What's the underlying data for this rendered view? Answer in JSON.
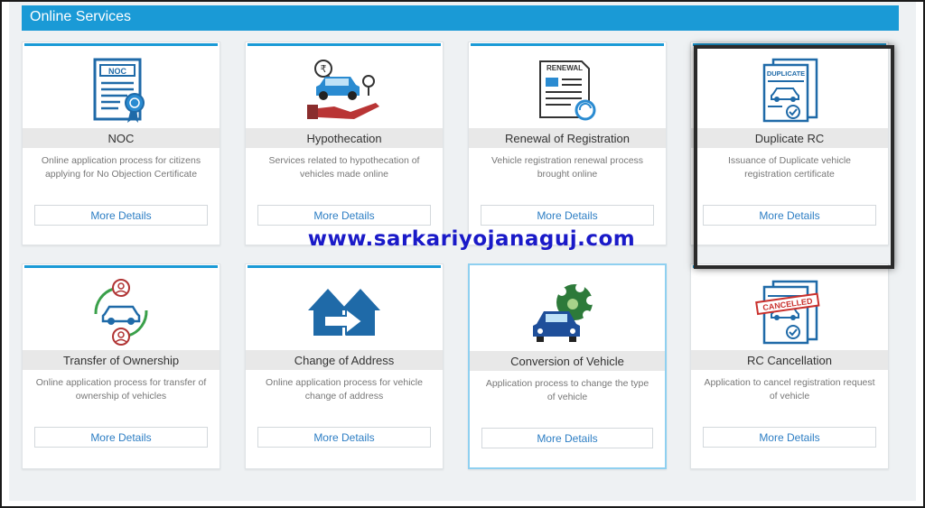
{
  "section": {
    "title": "Online Services"
  },
  "cards": [
    {
      "title": "NOC",
      "desc": "Online application process for citizens applying for No Objection Certificate",
      "button": "More Details",
      "icon": "noc-certificate-icon"
    },
    {
      "title": "Hypothecation",
      "desc": "Services related to hypothecation of vehicles made online",
      "button": "More Details",
      "icon": "car-hypothecation-icon"
    },
    {
      "title": "Renewal of Registration",
      "desc": "Vehicle registration renewal process brought online",
      "button": "More Details",
      "icon": "renewal-document-icon",
      "badge": "RENEWAL"
    },
    {
      "title": "Duplicate RC",
      "desc": "Issuance of Duplicate vehicle registration certificate",
      "button": "More Details",
      "icon": "duplicate-rc-icon",
      "badge": "DUPLICATE"
    },
    {
      "title": "Transfer of Ownership",
      "desc": "Online application process for transfer of ownership of vehicles",
      "button": "More Details",
      "icon": "transfer-ownership-icon"
    },
    {
      "title": "Change of Address",
      "desc": "Online application process for vehicle change of address",
      "button": "More Details",
      "icon": "change-address-icon"
    },
    {
      "title": "Conversion of Vehicle",
      "desc": "Application process to change the type of vehicle",
      "button": "More Details",
      "icon": "vehicle-conversion-icon"
    },
    {
      "title": "RC Cancellation",
      "desc": "Application to cancel registration request of vehicle",
      "button": "More Details",
      "icon": "rc-cancellation-icon",
      "badge": "CANCELLED"
    }
  ],
  "watermark": "www.sarkariyojanaguj.com",
  "colors": {
    "accent": "#1a9ad6",
    "icon_blue": "#1f6aa8",
    "link": "#2d7ec4",
    "watermark": "#1a1ac8"
  }
}
